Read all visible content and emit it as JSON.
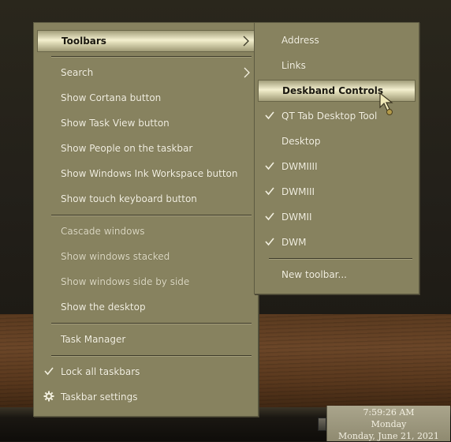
{
  "main_menu": {
    "items": [
      {
        "label": "Toolbars",
        "highlighted": true,
        "submenu": true
      },
      {
        "label": "Search",
        "submenu": true
      },
      {
        "label": "Show Cortana button"
      },
      {
        "label": "Show Task View button"
      },
      {
        "label": "Show People on the taskbar"
      },
      {
        "label": "Show Windows Ink Workspace button"
      },
      {
        "label": "Show touch keyboard button"
      },
      {
        "label": "Cascade windows",
        "disabled": true
      },
      {
        "label": "Show windows stacked",
        "disabled": true
      },
      {
        "label": "Show windows side by side",
        "disabled": true
      },
      {
        "label": "Show the desktop"
      },
      {
        "label": "Task Manager"
      },
      {
        "label": "Lock all taskbars",
        "checked": true
      },
      {
        "label": "Taskbar settings",
        "icon": "gear-icon"
      }
    ]
  },
  "sub_menu": {
    "items": [
      {
        "label": "Address"
      },
      {
        "label": "Links"
      },
      {
        "label": "Deskband Controls",
        "highlighted": true
      },
      {
        "label": "QT Tab Desktop Tool",
        "checked": true
      },
      {
        "label": "Desktop"
      },
      {
        "label": "DWMIIII",
        "checked": true
      },
      {
        "label": "DWMIII",
        "checked": true
      },
      {
        "label": "DWMII",
        "checked": true
      },
      {
        "label": "DWM",
        "checked": true
      },
      {
        "label": "New toolbar..."
      }
    ]
  },
  "clock": {
    "time": "7:59:26 AM",
    "day": "Monday",
    "date": "Monday, June 21, 2021"
  },
  "colors": {
    "menu_bg": "#87825f",
    "highlight": "#f4f0d0",
    "text": "#f4f1e1"
  }
}
